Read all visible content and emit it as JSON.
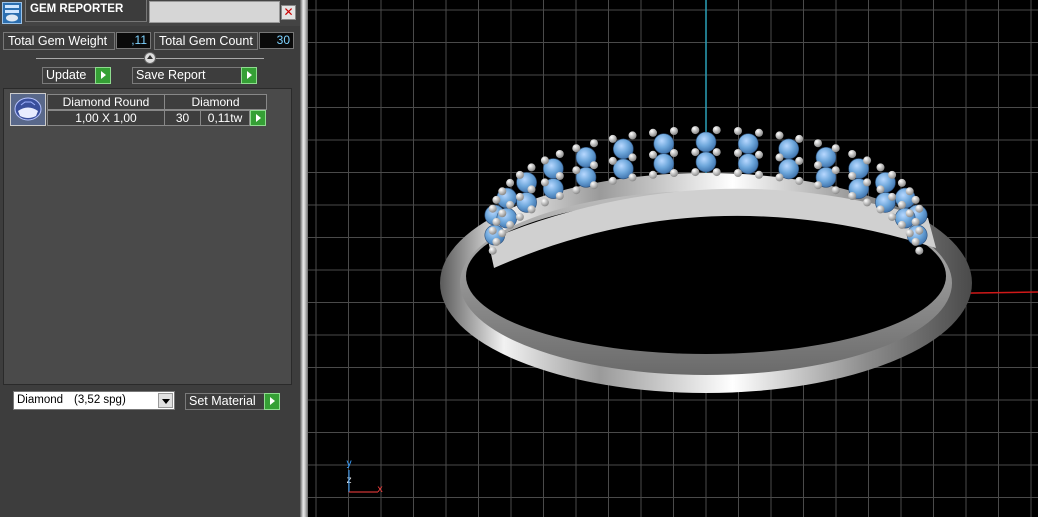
{
  "window": {
    "title": "GEM REPORTER",
    "close_glyph": "✕"
  },
  "summary": {
    "total_weight_label": "Total Gem Weight",
    "total_weight_value": ",11",
    "total_count_label": "Total Gem Count",
    "total_count_value": "30"
  },
  "buttons": {
    "update_label": "Update",
    "save_report_label": "Save Report",
    "set_material_label": "Set Material"
  },
  "report_table": {
    "header": {
      "shape": "Diamond Round",
      "material": "Diamond"
    },
    "rows": [
      {
        "size": "1,00 X 1,00",
        "count": "30",
        "weight": "0,11tw"
      }
    ]
  },
  "material_select": {
    "selected_name": "Diamond",
    "selected_spg": "(3,52 spg)"
  },
  "viewport": {
    "axis_labels": {
      "y": "y",
      "z": "z",
      "x": "x"
    }
  },
  "colors": {
    "panel_bg": "#3d3d3d",
    "value_text": "#7fd3ff",
    "go_button": "#35a035",
    "gem_blue": "#6fa8dc",
    "axis_x": "#ff2020",
    "axis_y": "#3aa0ff",
    "grid": "#4a4a4a"
  },
  "icons": {
    "app": "gem-reporter-icon",
    "close": "close-icon",
    "go": "play-arrow-icon",
    "dropdown": "chevron-down-icon",
    "gem_thumbnail": "round-gem-icon"
  }
}
